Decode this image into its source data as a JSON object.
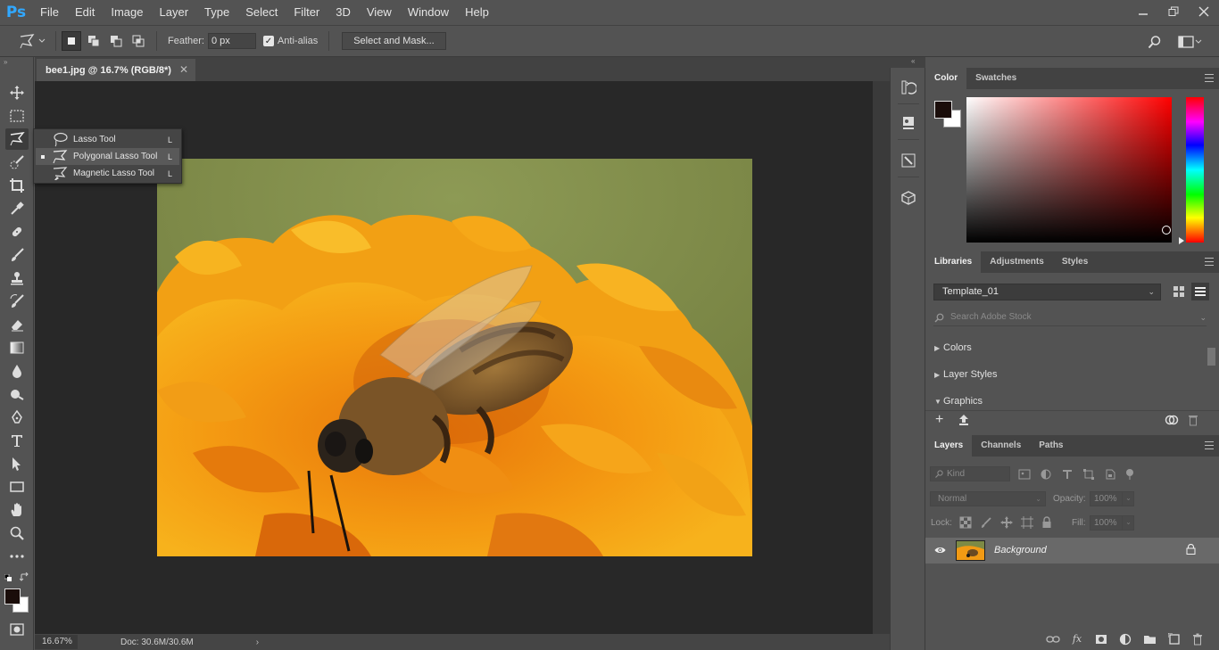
{
  "app": {
    "logo": "Ps",
    "menus": [
      "File",
      "Edit",
      "Image",
      "Layer",
      "Type",
      "Select",
      "Filter",
      "3D",
      "View",
      "Window",
      "Help"
    ],
    "window_controls": [
      "minimize-icon",
      "restore-icon",
      "close-icon"
    ]
  },
  "options_bar": {
    "tool_icon": "polygonal-lasso-icon",
    "feather_label": "Feather:",
    "feather_value": "0 px",
    "antialias_label": "Anti-alias",
    "antialias_checked": true,
    "select_mask_label": "Select and Mask..."
  },
  "document": {
    "tab_title": "bee1.jpg @ 16.7% (RGB/8*)",
    "zoom": "16.67%",
    "doc_info": "Doc: 30.6M/30.6M"
  },
  "tool_flyout": {
    "items": [
      {
        "label": "Lasso Tool",
        "shortcut": "L",
        "icon": "lasso-icon",
        "selected": false
      },
      {
        "label": "Polygonal Lasso Tool",
        "shortcut": "L",
        "icon": "polygonal-lasso-icon",
        "selected": true
      },
      {
        "label": "Magnetic Lasso Tool",
        "shortcut": "L",
        "icon": "magnetic-lasso-icon",
        "selected": false
      }
    ]
  },
  "color_panel": {
    "tabs": [
      "Color",
      "Swatches"
    ],
    "foreground": "#1a0d0a",
    "background": "#ffffff",
    "hue": "#ff0000"
  },
  "libraries_panel": {
    "tabs": [
      "Libraries",
      "Adjustments",
      "Styles"
    ],
    "library_name": "Template_01",
    "search_placeholder": "Search Adobe Stock",
    "sections": [
      {
        "label": "Colors",
        "expanded": false
      },
      {
        "label": "Layer Styles",
        "expanded": false
      },
      {
        "label": "Graphics",
        "expanded": true
      }
    ]
  },
  "layers_panel": {
    "tabs": [
      "Layers",
      "Channels",
      "Paths"
    ],
    "kind_label": "Kind",
    "blend_mode": "Normal",
    "opacity_label": "Opacity:",
    "opacity_value": "100%",
    "lock_label": "Lock:",
    "fill_label": "Fill:",
    "fill_value": "100%",
    "layers": [
      {
        "name": "Background",
        "visible": true,
        "locked": true
      }
    ],
    "footer_icons": [
      "link-icon",
      "fx-icon",
      "mask-icon",
      "adjustment-icon",
      "group-folder-icon",
      "new-layer-icon",
      "trash-icon"
    ]
  }
}
